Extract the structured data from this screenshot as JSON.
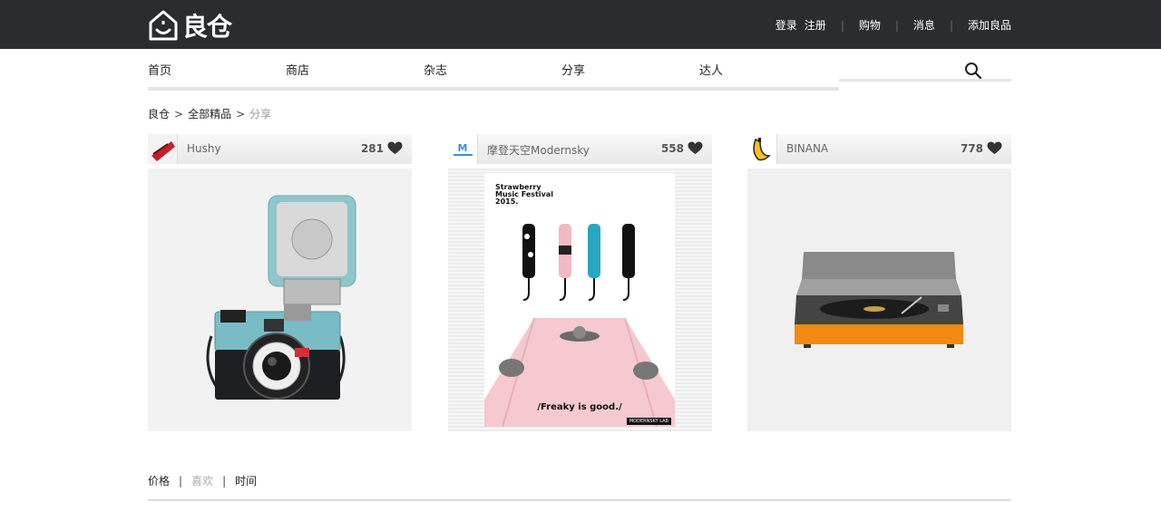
{
  "brand": {
    "name": "良仓"
  },
  "top_nav": {
    "login": "登录",
    "register": "注册",
    "cart": "购物",
    "messages": "消息",
    "add_item": "添加良品"
  },
  "main_nav": [
    "首页",
    "商店",
    "杂志",
    "分享",
    "达人"
  ],
  "search": {
    "placeholder": ""
  },
  "breadcrumb": {
    "home": "良仓",
    "category": "全部精品",
    "current": "分享",
    "separator": ">"
  },
  "cards": [
    {
      "name": "Hushy",
      "likes": "281",
      "image": "camera"
    },
    {
      "name": "摩登天空Modernsky",
      "likes": "558",
      "image": "strawberry-festival-umbrella-poster"
    },
    {
      "name": "BINANA",
      "likes": "778",
      "image": "orange-turntable"
    }
  ],
  "poster": {
    "title_line1": "Strawberry",
    "title_line2": "Music Festival",
    "year": "2015.",
    "slogan": "/Freaky is good./",
    "footer": "MODERNSKY LAB"
  },
  "filters": {
    "price": "价格",
    "like": "喜欢",
    "time": "时间",
    "separator": "|"
  }
}
